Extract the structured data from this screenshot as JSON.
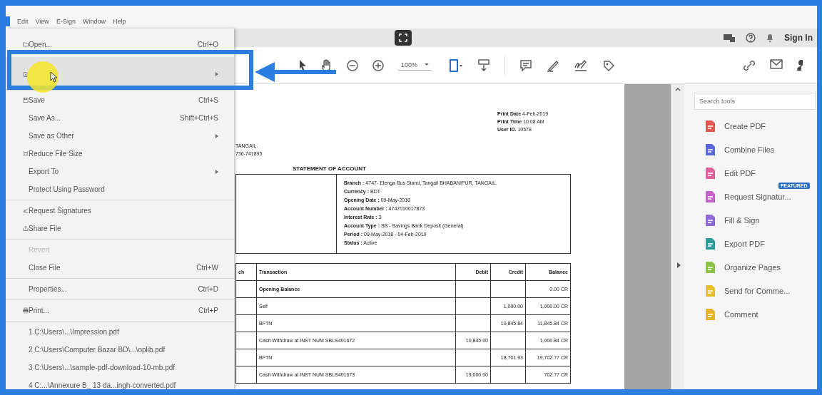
{
  "menubar": {
    "items": [
      "Edit",
      "View",
      "E-Sign",
      "Window",
      "Help"
    ]
  },
  "top_bar": {
    "sign_in": "Sign In"
  },
  "toolbar": {
    "zoom": "100%"
  },
  "file_menu": {
    "sections": [
      [
        {
          "label": "Open...",
          "shortcut": "Ctrl+O",
          "submenu": false,
          "selected": false,
          "disabled": false
        },
        {
          "submenu": true,
          "selected": true,
          "disabled": false
        },
        {
          "label": "Save",
          "shortcut": "Ctrl+S",
          "submenu": false,
          "selected": false,
          "disabled": false
        },
        {
          "label": "Save As...",
          "shortcut": "Shift+Ctrl+S",
          "submenu": false,
          "selected": false,
          "disabled": false
        },
        {
          "label": "Save as Other",
          "submenu": true,
          "selected": false,
          "disabled": false
        },
        {
          "label": "Reduce File Size",
          "submenu": false,
          "selected": false,
          "disabled": false
        },
        {
          "label": "Export To",
          "submenu": true,
          "selected": false,
          "disabled": false
        },
        {
          "label": "Protect Using Password",
          "submenu": false,
          "selected": false,
          "disabled": false
        }
      ],
      [
        {
          "label": "Request Signatures",
          "submenu": false,
          "selected": false,
          "disabled": false
        },
        {
          "label": "Share File",
          "submenu": false,
          "selected": false,
          "disabled": false
        }
      ],
      [
        {
          "label": "Revert",
          "submenu": false,
          "selected": false,
          "disabled": true
        },
        {
          "label": "Close File",
          "shortcut": "Ctrl+W",
          "submenu": false,
          "selected": false,
          "disabled": false
        }
      ],
      [
        {
          "label": "Properties...",
          "shortcut": "Ctrl+D",
          "submenu": false,
          "selected": false,
          "disabled": false
        }
      ],
      [
        {
          "label": "Print...",
          "shortcut": "Ctrl+P",
          "submenu": false,
          "selected": false,
          "disabled": false
        }
      ],
      [
        {
          "label": "1 C:\\Users\\...\\Impression.pdf",
          "submenu": false,
          "selected": false,
          "disabled": false
        },
        {
          "label": "2 C:\\Users\\Computer Bazar BD\\...\\oplib.pdf",
          "submenu": false,
          "selected": false,
          "disabled": false
        },
        {
          "label": "3 C:\\Users\\...\\sample-pdf-download-10-mb.pdf",
          "submenu": false,
          "selected": false,
          "disabled": false
        },
        {
          "label": "4 C:...\\Annexure B_ 13 da...ingh-converted.pdf",
          "submenu": false,
          "selected": false,
          "disabled": false
        }
      ]
    ]
  },
  "document": {
    "print_info": [
      "**Print Date** 4-Feb-2019",
      "**Print Time** 10:08 AM",
      "**User ID.** 10578"
    ],
    "address_lines": [
      "TANGAIL.",
      "736-741895"
    ],
    "title": "STATEMENT OF ACCOUNT",
    "account_info": [
      "**Branch :** 4747- Elenga Bus Stand, Tangail BHABANIPUR, TANGAIL.",
      "**Currency :** BDT",
      "**Opening Date :** 09-May-2018",
      "**Account Number :** 4747010017873",
      "**Interest Rate :** 3",
      "**Account Type :** SB - Savings Bank Deposit (General)",
      "**Period :** 09-May-2018 - 04-Feb-2019",
      "**Status :** Active"
    ],
    "table": {
      "columns": [
        "ch",
        "Transaction",
        "Debit",
        "Credit",
        "Balance"
      ],
      "rows": [
        {
          "transaction": "Opening Balance",
          "balance": "0.00 CR",
          "bold": true
        },
        {
          "transaction": "Self",
          "credit": "1,000.00",
          "balance": "1,000.00 CR",
          "bold": false
        },
        {
          "transaction": "BFTN",
          "credit": "10,845.84",
          "balance": "11,845.84 CR",
          "bold": false
        },
        {
          "transaction": "Cash Withdraw at INST NUM SBLS401672",
          "debit": "10,845.00",
          "balance": "1,000.84 CR",
          "bold": false
        },
        {
          "transaction": "BFTN",
          "credit": "18,701.93",
          "balance": "19,702.77 CR",
          "bold": false
        },
        {
          "transaction": "Cash Withdraw at INST NUM SBLS401673",
          "debit": "19,000.00",
          "balance": "702.77 CR",
          "bold": false
        }
      ]
    }
  },
  "tools_panel": {
    "search": {
      "placeholder": "Search tools"
    },
    "items": [
      {
        "label": "Create PDF",
        "color": "#e0584f"
      },
      {
        "label": "Combine Files",
        "color": "#5a67d8"
      },
      {
        "label": "Edit PDF",
        "color": "#e0609a"
      },
      {
        "label": "Request Signatur...",
        "color": "#c564c8",
        "badge": "FEATURED"
      },
      {
        "label": "Fill & Sign",
        "color": "#8c6bd6"
      },
      {
        "label": "Export PDF",
        "color": "#2f9c9c"
      },
      {
        "label": "Organize Pages",
        "color": "#8bc34a"
      },
      {
        "label": "Send for Comme...",
        "color": "#e6c028"
      },
      {
        "label": "Comment",
        "color": "#e6b422"
      }
    ]
  }
}
